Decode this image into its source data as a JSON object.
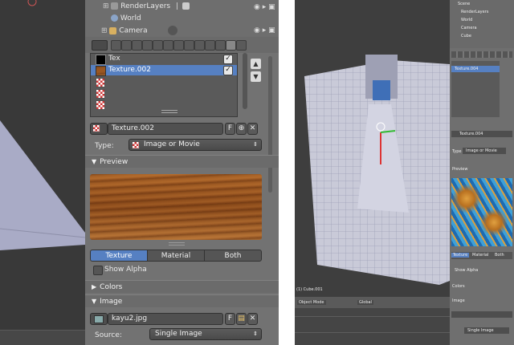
{
  "left": {
    "outliner": {
      "items": [
        "RenderLayers",
        "World",
        "Camera"
      ]
    },
    "texture_slots": {
      "items": [
        "Tex",
        "Texture.002"
      ],
      "selected": "Texture.002"
    },
    "texture_name": {
      "value": "Texture.002",
      "fake_user": "F"
    },
    "type": {
      "label": "Type:",
      "value": "Image or Movie"
    },
    "preview": {
      "header": "Preview",
      "tabs": [
        "Texture",
        "Material",
        "Both"
      ],
      "active_tab": "Texture",
      "show_alpha": "Show Alpha"
    },
    "colors": {
      "header": "Colors"
    },
    "image": {
      "header": "Image",
      "file": "kayu2.jpg",
      "fake_user": "F",
      "source_label": "Source:",
      "source_value": "Single Image"
    }
  },
  "right": {
    "outliner": {
      "items": [
        "Scene",
        "RenderLayers",
        "World",
        "Camera",
        "Cube"
      ]
    },
    "texture_slot": "Texture.004",
    "texture_name": "Texture.004",
    "type_value": "Image or Movie",
    "preview_header": "Preview",
    "tabs": [
      "Texture",
      "Material",
      "Both"
    ],
    "show_alpha": "Show Alpha",
    "colors_header": "Colors",
    "image_header": "Image",
    "source_value": "Single Image",
    "viewport_label": "(1) Cube.001",
    "mode": "Object Mode",
    "orientation": "Global"
  },
  "colors": {
    "selection": "#5680c2",
    "panel": "#727272",
    "viewport": "#393939"
  }
}
